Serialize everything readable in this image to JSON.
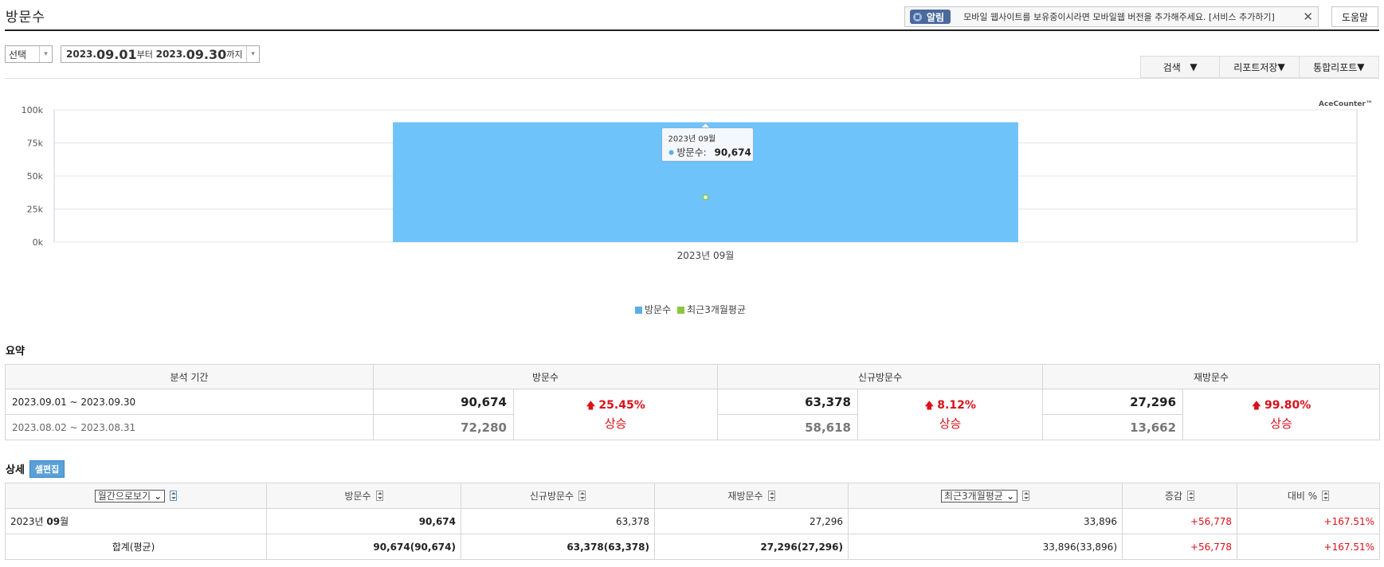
{
  "header": {
    "title": "방문수",
    "notice_badge": "알림",
    "notice_text": "모바일 웹사이트를 보유중이시라면 모바일웹 버전을 추가해주세요. [서비스 추가하기]",
    "help_label": "도움말"
  },
  "filters": {
    "period_select": "선택",
    "date_start": "2023.09.01",
    "date_start_y": "2023.",
    "date_start_md": "09.01",
    "date_from_suffix": "부터",
    "date_end_y": "2023.",
    "date_end_md": "09.30",
    "date_to_suffix": "까지"
  },
  "toolbar": {
    "search_label": "검색",
    "save_label": "리포트저장",
    "integrated_label": "통합리포트"
  },
  "chart_data": {
    "type": "bar",
    "categories": [
      "2023년 09월"
    ],
    "series": [
      {
        "name": "방문수",
        "values": [
          90674
        ],
        "color": "#6ec3fa"
      },
      {
        "name": "최근3개월평균",
        "values": [
          33896
        ],
        "color": "#8cc63f"
      }
    ],
    "ylim": [
      0,
      100000
    ],
    "yticks": [
      "0k",
      "25k",
      "50k",
      "75k",
      "100k"
    ],
    "ytick_values": [
      0,
      25000,
      50000,
      75000,
      100000
    ],
    "tooltip": {
      "title": "2023년 09월",
      "label": "방문수:",
      "value": "90,674"
    },
    "brand": "AceCounter™",
    "legend_position": "bottom",
    "grid": true
  },
  "summary": {
    "title": "요약",
    "headers": [
      "분석 기간",
      "방문수",
      "신규방문수",
      "재방문수"
    ],
    "current_period": "2023.09.01 ~ 2023.09.30",
    "previous_period": "2023.08.02 ~ 2023.08.31",
    "visits": {
      "current": "90,674",
      "previous": "72,280",
      "pct": "25.45%",
      "word": "상승"
    },
    "new_visits": {
      "current": "63,378",
      "previous": "58,618",
      "pct": "8.12%",
      "word": "상승"
    },
    "return_visits": {
      "current": "27,296",
      "previous": "13,662",
      "pct": "99.80%",
      "word": "상승"
    }
  },
  "detail": {
    "title": "상세",
    "edit_label": "셀편집",
    "view_select": "월간으로보기",
    "avg_select": "최근3개월평균",
    "headers": {
      "visits": "방문수",
      "new": "신규방문수",
      "return": "재방문수",
      "change": "증감",
      "ratio": "대비 %"
    },
    "row": {
      "label_pre": "2023년 ",
      "label_bold": "09",
      "label_post": "월",
      "visits": "90,674",
      "new": "63,378",
      "return": "27,296",
      "avg": "33,896",
      "change": "+56,778",
      "ratio": "+167.51%"
    },
    "total": {
      "label": "합계(평균)",
      "visits": "90,674(90,674)",
      "new": "63,378(63,378)",
      "return": "27,296(27,296)",
      "avg": "33,896(33,896)",
      "change": "+56,778",
      "ratio": "+167.51%"
    }
  }
}
